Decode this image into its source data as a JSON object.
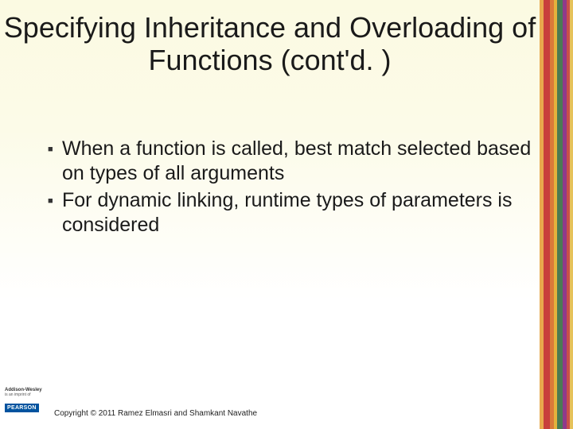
{
  "title": "Specifying Inheritance and Overloading of Functions (cont'd. )",
  "bullets": [
    "When a function is called, best match selected based on types of all arguments",
    "For dynamic linking, runtime types of parameters is considered"
  ],
  "footer": {
    "publisher_line1": "Addison-Wesley",
    "publisher_line2": "is an imprint of",
    "brand": "PEARSON",
    "copyright": "Copyright © 2011 Ramez Elmasri and Shamkant Navathe"
  }
}
